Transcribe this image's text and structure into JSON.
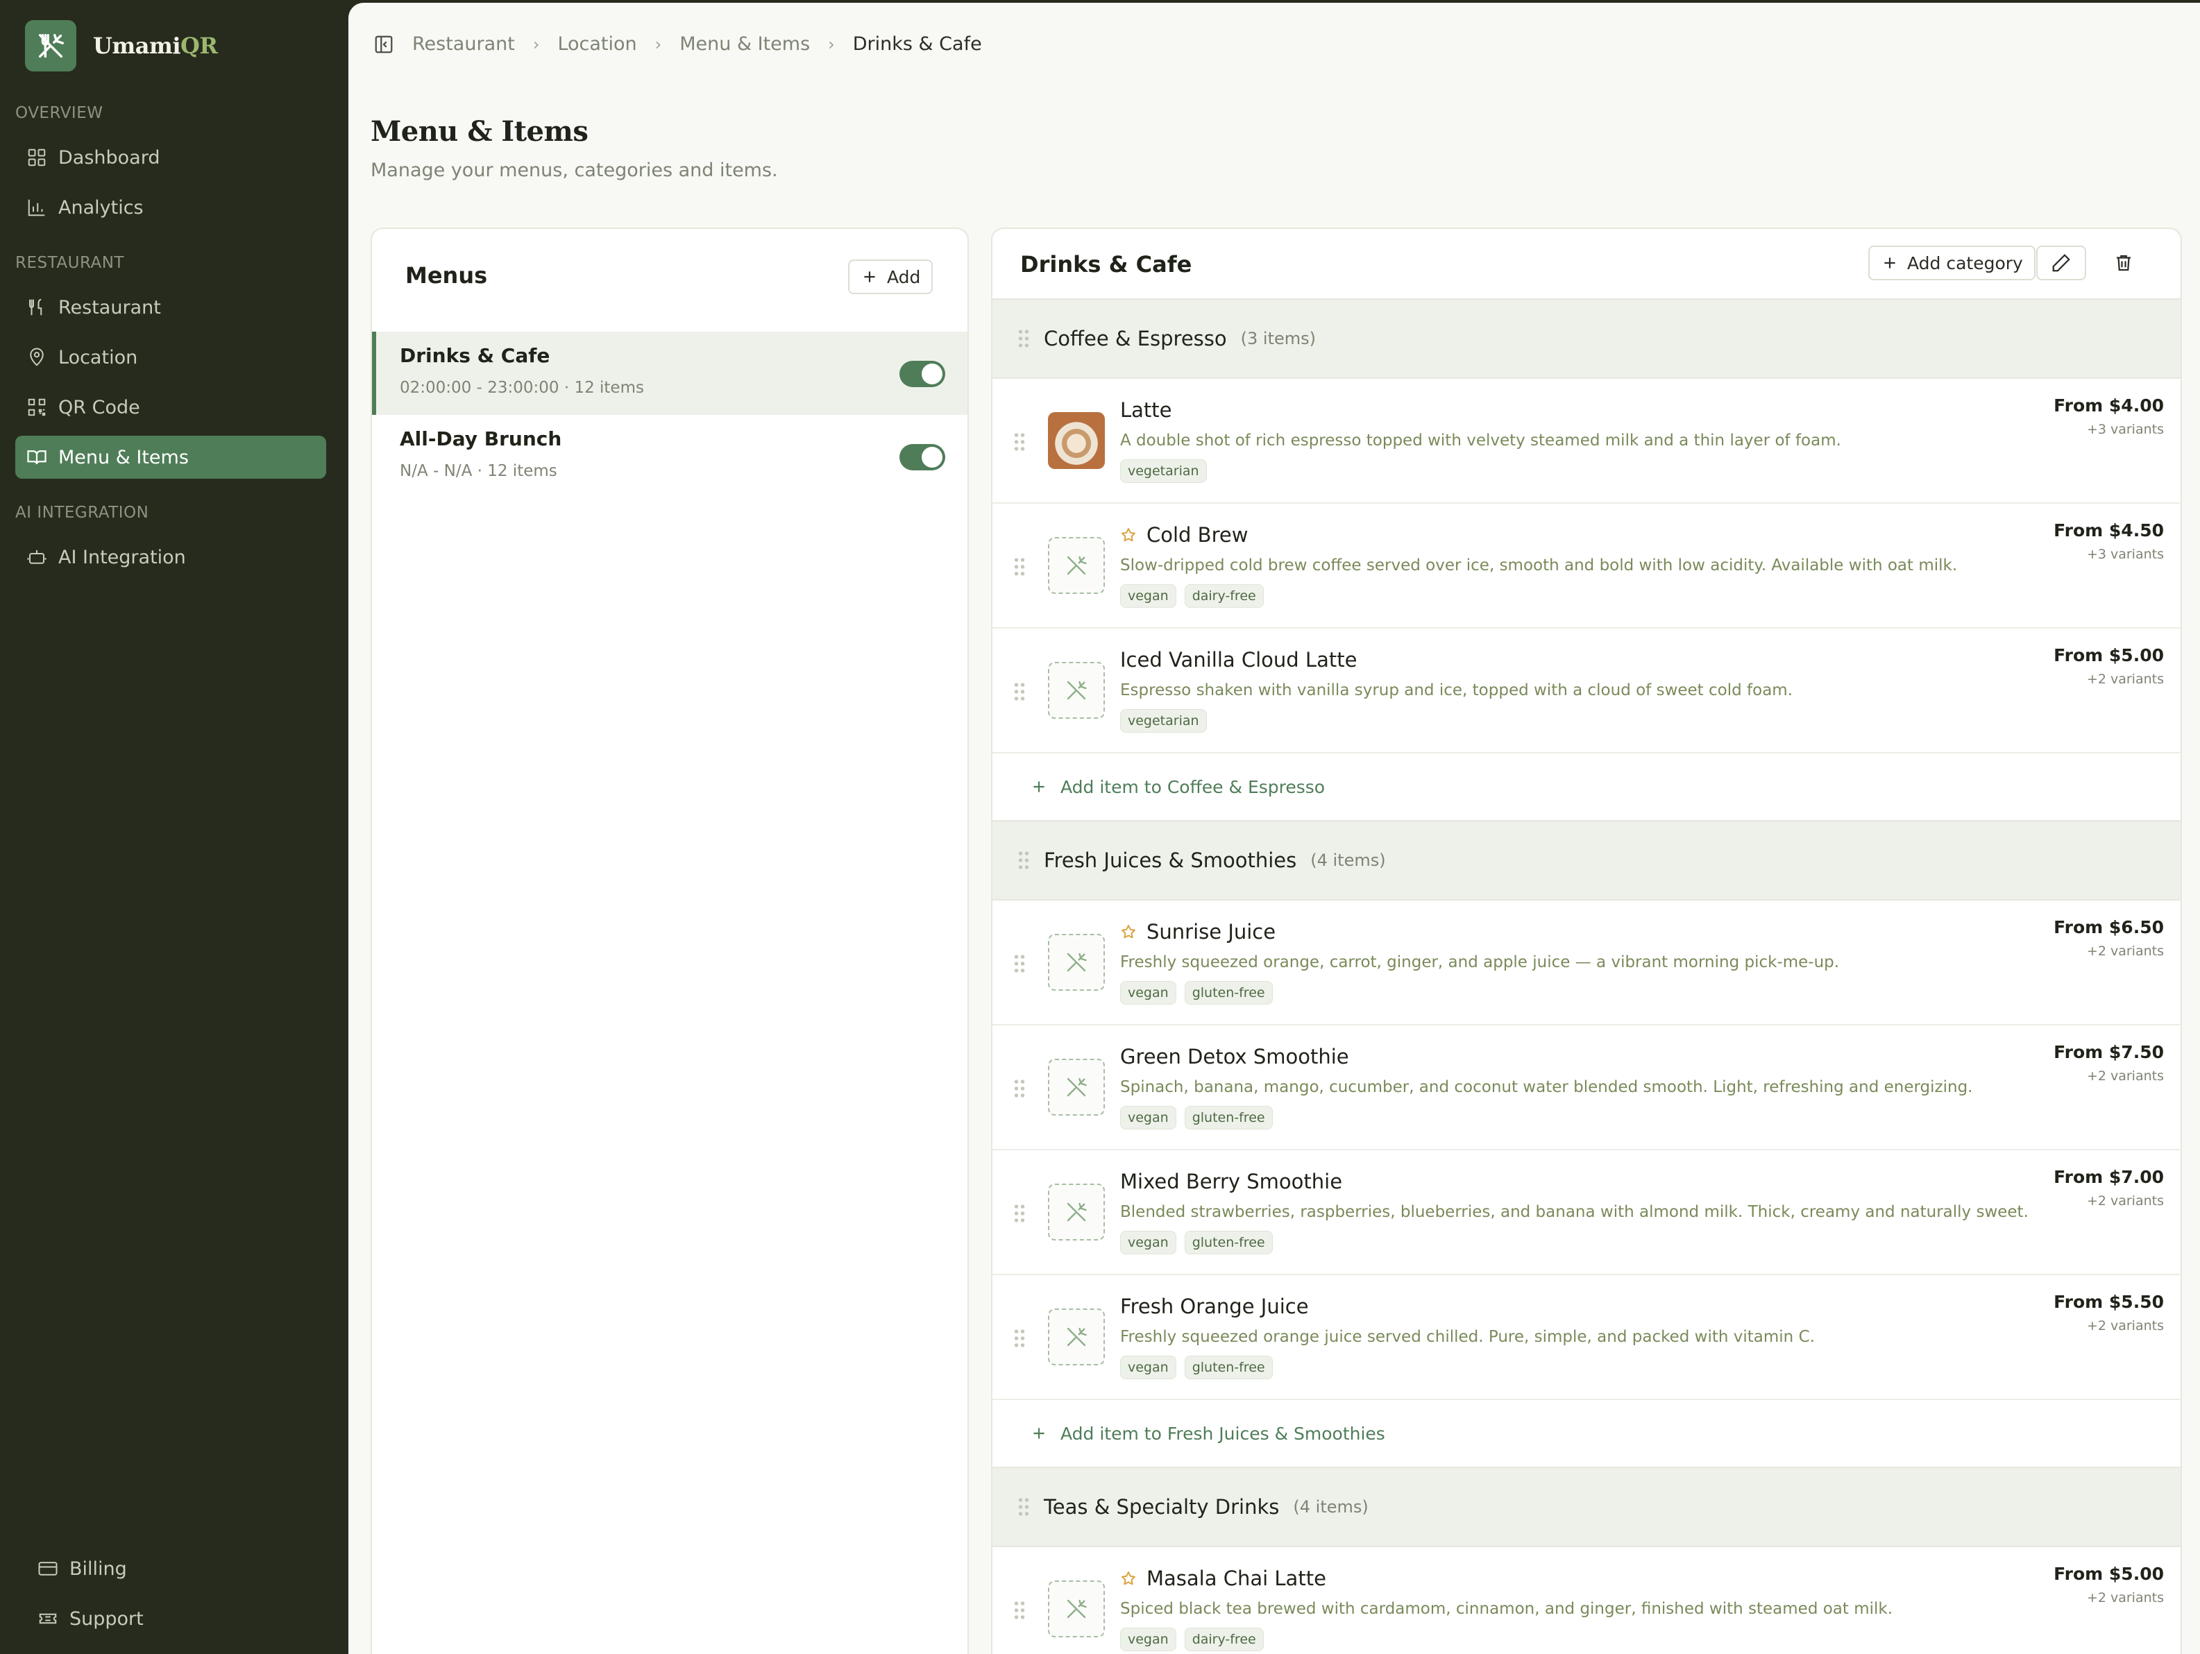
{
  "brand": {
    "name_main": "Umami",
    "name_accent": "QR",
    "accent_color": "#9cb86f",
    "logo_icon": "utensils-crossed-icon"
  },
  "sidebar": {
    "sections": [
      {
        "label": "OVERVIEW",
        "items": [
          {
            "label": "Dashboard",
            "icon": "grid-icon"
          },
          {
            "label": "Analytics",
            "icon": "bar-chart-icon"
          }
        ]
      },
      {
        "label": "RESTAURANT",
        "items": [
          {
            "label": "Restaurant",
            "icon": "utensils-icon"
          },
          {
            "label": "Location",
            "icon": "map-pin-icon"
          },
          {
            "label": "QR Code",
            "icon": "qr-code-icon"
          },
          {
            "label": "Menu & Items",
            "icon": "book-open-icon",
            "active": true
          }
        ]
      },
      {
        "label": "AI INTEGRATION",
        "items": [
          {
            "label": "AI Integration",
            "icon": "bot-icon"
          }
        ]
      }
    ],
    "footer": [
      {
        "label": "Billing",
        "icon": "credit-card-icon"
      },
      {
        "label": "Support",
        "icon": "ticket-icon"
      }
    ]
  },
  "breadcrumb": [
    "Restaurant",
    "Location",
    "Menu & Items",
    "Drinks & Cafe"
  ],
  "page": {
    "title": "Menu & Items",
    "subtitle": "Manage your menus, categories and items."
  },
  "menus_panel": {
    "title": "Menus",
    "add_label": "Add",
    "menus": [
      {
        "name": "Drinks & Cafe",
        "meta": "02:00:00 - 23:00:00 · 12 items",
        "enabled": true,
        "selected": true
      },
      {
        "name": "All-Day Brunch",
        "meta": "N/A - N/A · 12 items",
        "enabled": true,
        "selected": false
      }
    ]
  },
  "detail": {
    "title": "Drinks & Cafe",
    "add_category_label": "Add category",
    "categories": [
      {
        "name": "Coffee & Espresso",
        "count": "(3 items)",
        "add_label": "Add item to Coffee & Espresso",
        "items": [
          {
            "name": "Latte",
            "featured": false,
            "photo": true,
            "description": "A double shot of rich espresso topped with velvety steamed milk and a thin layer of foam.",
            "tags": [
              "vegetarian"
            ],
            "price": "From $4.00",
            "variants": "+3 variants"
          },
          {
            "name": "Cold Brew",
            "featured": true,
            "photo": false,
            "description": "Slow-dripped cold brew coffee served over ice, smooth and bold with low acidity. Available with oat milk.",
            "tags": [
              "vegan",
              "dairy-free"
            ],
            "price": "From $4.50",
            "variants": "+3 variants"
          },
          {
            "name": "Iced Vanilla Cloud Latte",
            "featured": false,
            "photo": false,
            "description": "Espresso shaken with vanilla syrup and ice, topped with a cloud of sweet cold foam.",
            "tags": [
              "vegetarian"
            ],
            "price": "From $5.00",
            "variants": "+2 variants"
          }
        ]
      },
      {
        "name": "Fresh Juices & Smoothies",
        "count": "(4 items)",
        "add_label": "Add item to Fresh Juices & Smoothies",
        "items": [
          {
            "name": "Sunrise Juice",
            "featured": true,
            "photo": false,
            "description": "Freshly squeezed orange, carrot, ginger, and apple juice — a vibrant morning pick-me-up.",
            "tags": [
              "vegan",
              "gluten-free"
            ],
            "price": "From $6.50",
            "variants": "+2 variants"
          },
          {
            "name": "Green Detox Smoothie",
            "featured": false,
            "photo": false,
            "description": "Spinach, banana, mango, cucumber, and coconut water blended smooth. Light, refreshing and energizing.",
            "tags": [
              "vegan",
              "gluten-free"
            ],
            "price": "From $7.50",
            "variants": "+2 variants"
          },
          {
            "name": "Mixed Berry Smoothie",
            "featured": false,
            "photo": false,
            "description": "Blended strawberries, raspberries, blueberries, and banana with almond milk. Thick, creamy and naturally sweet.",
            "tags": [
              "vegan",
              "gluten-free"
            ],
            "price": "From $7.00",
            "variants": "+2 variants"
          },
          {
            "name": "Fresh Orange Juice",
            "featured": false,
            "photo": false,
            "description": "Freshly squeezed orange juice served chilled. Pure, simple, and packed with vitamin C.",
            "tags": [
              "vegan",
              "gluten-free"
            ],
            "price": "From $5.50",
            "variants": "+2 variants"
          }
        ]
      },
      {
        "name": "Teas & Specialty Drinks",
        "count": "(4 items)",
        "add_label": "",
        "items": [
          {
            "name": "Masala Chai Latte",
            "featured": true,
            "photo": false,
            "description": "Spiced black tea brewed with cardamom, cinnamon, and ginger, finished with steamed oat milk.",
            "tags": [
              "vegan",
              "dairy-free"
            ],
            "price": "From $5.00",
            "variants": "+2 variants"
          }
        ]
      }
    ]
  },
  "colors": {
    "sidebar_bg": "#272b1d",
    "accent_green": "#4f7d58",
    "category_bg": "#eef1ea",
    "featured_star": "#d9a441"
  }
}
